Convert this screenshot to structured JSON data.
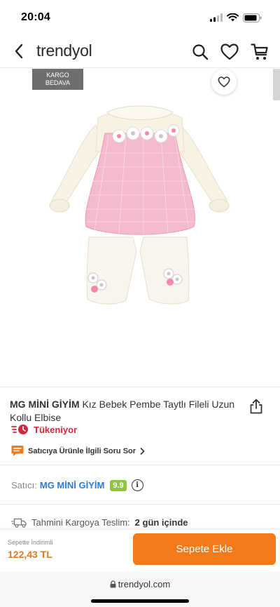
{
  "status": {
    "time": "20:04"
  },
  "nav": {
    "brand": "trendyol"
  },
  "gallery": {
    "badge": [
      "KARGO",
      "BEDAVA"
    ]
  },
  "product": {
    "brand": "MG MİNİ GİYİM",
    "title": "Kız Bebek Pembe Taytlı Fileli Uzun Kollu Elbise",
    "stock_status": "Tükeniyor",
    "qa_link": "Satıcıya Ürünle İlgili Soru Sor"
  },
  "seller": {
    "label": "Satıcı:",
    "name": "MG MİNİ GİYİM",
    "score": "9.9"
  },
  "delivery": {
    "label": "Tahmini Kargoya Teslim:",
    "value": "2 gün içinde"
  },
  "cart": {
    "price_label": "Sepette İndirimli",
    "price": "122,43 TL",
    "add_label": "Sepete Ekle"
  },
  "browser": {
    "url": "trendyol.com"
  },
  "colors": {
    "accent": "#f27a1a",
    "stock_red": "#d6263a",
    "seller_blue": "#2b7bd9",
    "score_green": "#8fc63f"
  }
}
